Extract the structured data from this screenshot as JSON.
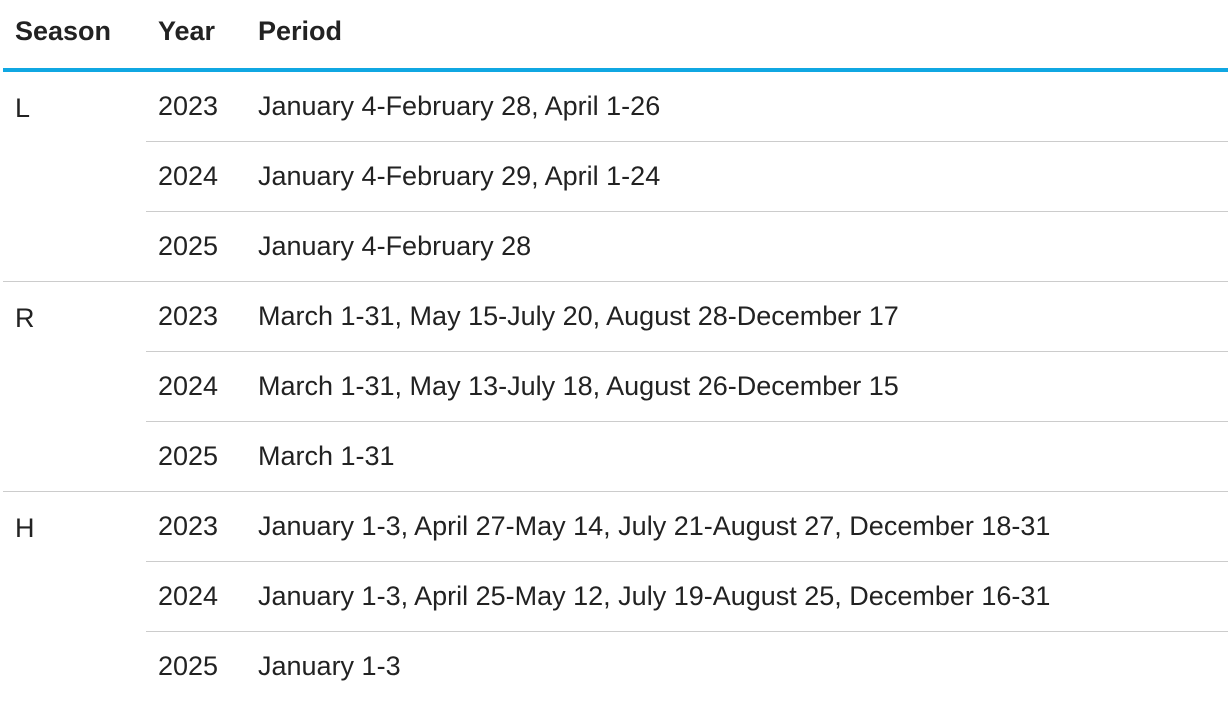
{
  "table": {
    "headers": {
      "season": "Season",
      "year": "Year",
      "period": "Period"
    },
    "accent_color": "#10a7e2",
    "groups": [
      {
        "season": "L",
        "rows": [
          {
            "year": "2023",
            "period": "January 4-February 28, April 1-26"
          },
          {
            "year": "2024",
            "period": "January 4-February 29, April 1-24"
          },
          {
            "year": "2025",
            "period": "January 4-February 28"
          }
        ]
      },
      {
        "season": "R",
        "rows": [
          {
            "year": "2023",
            "period": "March 1-31, May 15-July 20, August 28-December 17"
          },
          {
            "year": "2024",
            "period": "March 1-31, May 13-July 18, August 26-December 15"
          },
          {
            "year": "2025",
            "period": "March 1-31"
          }
        ]
      },
      {
        "season": "H",
        "rows": [
          {
            "year": "2023",
            "period": "January 1-3, April 27-May 14, July 21-August 27, December 18-31"
          },
          {
            "year": "2024",
            "period": "January 1-3, April 25-May 12, July 19-August 25, December 16-31"
          },
          {
            "year": "2025",
            "period": "January 1-3"
          }
        ]
      }
    ]
  }
}
